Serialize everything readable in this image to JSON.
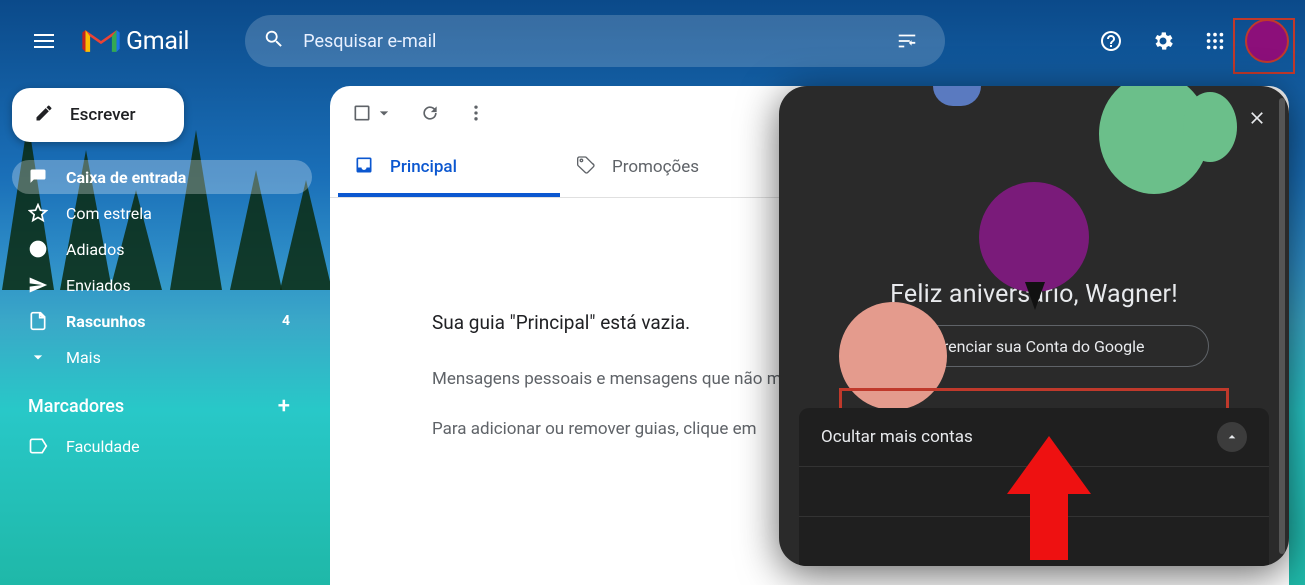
{
  "header": {
    "app_name": "Gmail",
    "search_placeholder": "Pesquisar e-mail"
  },
  "compose_label": "Escrever",
  "nav": [
    {
      "key": "inbox",
      "label": "Caixa de entrada",
      "active": true,
      "bold": true
    },
    {
      "key": "starred",
      "label": "Com estrela"
    },
    {
      "key": "snoozed",
      "label": "Adiados"
    },
    {
      "key": "sent",
      "label": "Enviados"
    },
    {
      "key": "drafts",
      "label": "Rascunhos",
      "badge": "4",
      "bold": true
    },
    {
      "key": "more",
      "label": "Mais"
    }
  ],
  "labels_title": "Marcadores",
  "labels": [
    {
      "key": "faculdade",
      "label": "Faculdade"
    }
  ],
  "tabs": {
    "primary": "Principal",
    "promotions": "Promoções"
  },
  "empty": {
    "title": "Sua guia \"Principal\" está vazia.",
    "line1": "Mensagens pessoais e mensagens que não mostradas aqui.",
    "line2_a": "Para adicionar ou remover guias, clique em ",
    "line2_b": ""
  },
  "account": {
    "greeting": "Feliz aniversário, Wagner!",
    "manage": "Gerenciar sua Conta do Google",
    "more": "Ocultar mais contas"
  }
}
